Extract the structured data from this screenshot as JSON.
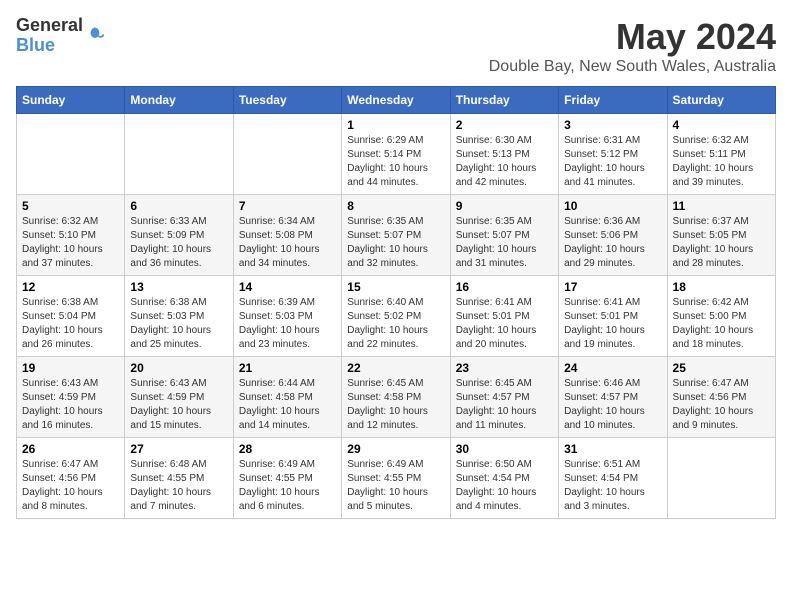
{
  "logo": {
    "line1": "General",
    "line2": "Blue"
  },
  "title": "May 2024",
  "location": "Double Bay, New South Wales, Australia",
  "days_header": [
    "Sunday",
    "Monday",
    "Tuesday",
    "Wednesday",
    "Thursday",
    "Friday",
    "Saturday"
  ],
  "weeks": [
    [
      {
        "day": "",
        "info": ""
      },
      {
        "day": "",
        "info": ""
      },
      {
        "day": "",
        "info": ""
      },
      {
        "day": "1",
        "info": "Sunrise: 6:29 AM\nSunset: 5:14 PM\nDaylight: 10 hours\nand 44 minutes."
      },
      {
        "day": "2",
        "info": "Sunrise: 6:30 AM\nSunset: 5:13 PM\nDaylight: 10 hours\nand 42 minutes."
      },
      {
        "day": "3",
        "info": "Sunrise: 6:31 AM\nSunset: 5:12 PM\nDaylight: 10 hours\nand 41 minutes."
      },
      {
        "day": "4",
        "info": "Sunrise: 6:32 AM\nSunset: 5:11 PM\nDaylight: 10 hours\nand 39 minutes."
      }
    ],
    [
      {
        "day": "5",
        "info": "Sunrise: 6:32 AM\nSunset: 5:10 PM\nDaylight: 10 hours\nand 37 minutes."
      },
      {
        "day": "6",
        "info": "Sunrise: 6:33 AM\nSunset: 5:09 PM\nDaylight: 10 hours\nand 36 minutes."
      },
      {
        "day": "7",
        "info": "Sunrise: 6:34 AM\nSunset: 5:08 PM\nDaylight: 10 hours\nand 34 minutes."
      },
      {
        "day": "8",
        "info": "Sunrise: 6:35 AM\nSunset: 5:07 PM\nDaylight: 10 hours\nand 32 minutes."
      },
      {
        "day": "9",
        "info": "Sunrise: 6:35 AM\nSunset: 5:07 PM\nDaylight: 10 hours\nand 31 minutes."
      },
      {
        "day": "10",
        "info": "Sunrise: 6:36 AM\nSunset: 5:06 PM\nDaylight: 10 hours\nand 29 minutes."
      },
      {
        "day": "11",
        "info": "Sunrise: 6:37 AM\nSunset: 5:05 PM\nDaylight: 10 hours\nand 28 minutes."
      }
    ],
    [
      {
        "day": "12",
        "info": "Sunrise: 6:38 AM\nSunset: 5:04 PM\nDaylight: 10 hours\nand 26 minutes."
      },
      {
        "day": "13",
        "info": "Sunrise: 6:38 AM\nSunset: 5:03 PM\nDaylight: 10 hours\nand 25 minutes."
      },
      {
        "day": "14",
        "info": "Sunrise: 6:39 AM\nSunset: 5:03 PM\nDaylight: 10 hours\nand 23 minutes."
      },
      {
        "day": "15",
        "info": "Sunrise: 6:40 AM\nSunset: 5:02 PM\nDaylight: 10 hours\nand 22 minutes."
      },
      {
        "day": "16",
        "info": "Sunrise: 6:41 AM\nSunset: 5:01 PM\nDaylight: 10 hours\nand 20 minutes."
      },
      {
        "day": "17",
        "info": "Sunrise: 6:41 AM\nSunset: 5:01 PM\nDaylight: 10 hours\nand 19 minutes."
      },
      {
        "day": "18",
        "info": "Sunrise: 6:42 AM\nSunset: 5:00 PM\nDaylight: 10 hours\nand 18 minutes."
      }
    ],
    [
      {
        "day": "19",
        "info": "Sunrise: 6:43 AM\nSunset: 4:59 PM\nDaylight: 10 hours\nand 16 minutes."
      },
      {
        "day": "20",
        "info": "Sunrise: 6:43 AM\nSunset: 4:59 PM\nDaylight: 10 hours\nand 15 minutes."
      },
      {
        "day": "21",
        "info": "Sunrise: 6:44 AM\nSunset: 4:58 PM\nDaylight: 10 hours\nand 14 minutes."
      },
      {
        "day": "22",
        "info": "Sunrise: 6:45 AM\nSunset: 4:58 PM\nDaylight: 10 hours\nand 12 minutes."
      },
      {
        "day": "23",
        "info": "Sunrise: 6:45 AM\nSunset: 4:57 PM\nDaylight: 10 hours\nand 11 minutes."
      },
      {
        "day": "24",
        "info": "Sunrise: 6:46 AM\nSunset: 4:57 PM\nDaylight: 10 hours\nand 10 minutes."
      },
      {
        "day": "25",
        "info": "Sunrise: 6:47 AM\nSunset: 4:56 PM\nDaylight: 10 hours\nand 9 minutes."
      }
    ],
    [
      {
        "day": "26",
        "info": "Sunrise: 6:47 AM\nSunset: 4:56 PM\nDaylight: 10 hours\nand 8 minutes."
      },
      {
        "day": "27",
        "info": "Sunrise: 6:48 AM\nSunset: 4:55 PM\nDaylight: 10 hours\nand 7 minutes."
      },
      {
        "day": "28",
        "info": "Sunrise: 6:49 AM\nSunset: 4:55 PM\nDaylight: 10 hours\nand 6 minutes."
      },
      {
        "day": "29",
        "info": "Sunrise: 6:49 AM\nSunset: 4:55 PM\nDaylight: 10 hours\nand 5 minutes."
      },
      {
        "day": "30",
        "info": "Sunrise: 6:50 AM\nSunset: 4:54 PM\nDaylight: 10 hours\nand 4 minutes."
      },
      {
        "day": "31",
        "info": "Sunrise: 6:51 AM\nSunset: 4:54 PM\nDaylight: 10 hours\nand 3 minutes."
      },
      {
        "day": "",
        "info": ""
      }
    ]
  ]
}
